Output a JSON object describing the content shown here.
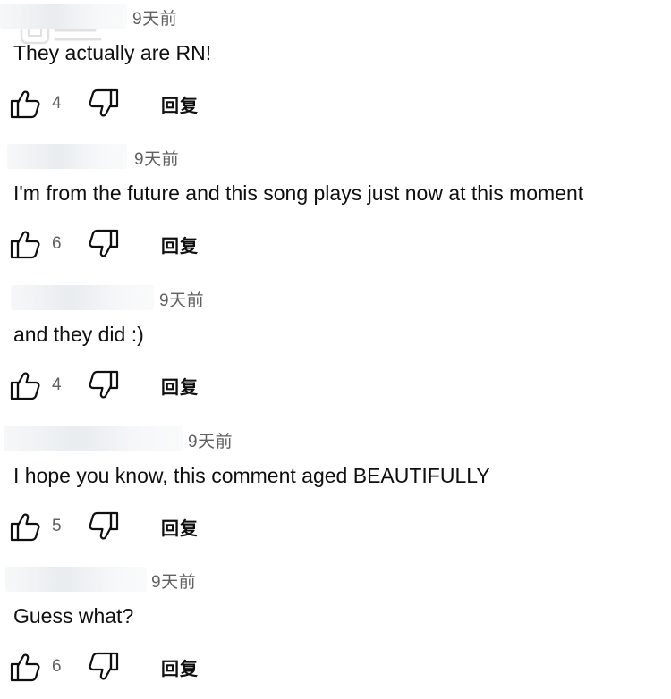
{
  "reply_label": "回复",
  "comments": [
    {
      "time": "9天前",
      "text": "They actually are RN!",
      "likes": "4"
    },
    {
      "time": "9天前",
      "text": "I'm from the future and this song plays just now at this moment",
      "likes": "6"
    },
    {
      "time": "9天前",
      "text": "and they did :)",
      "likes": "4"
    },
    {
      "time": "9天前",
      "text": "I hope you know, this comment aged BEAUTIFULLY",
      "likes": "5"
    },
    {
      "time": "9天前",
      "text": "Guess what?",
      "likes": "6"
    }
  ]
}
